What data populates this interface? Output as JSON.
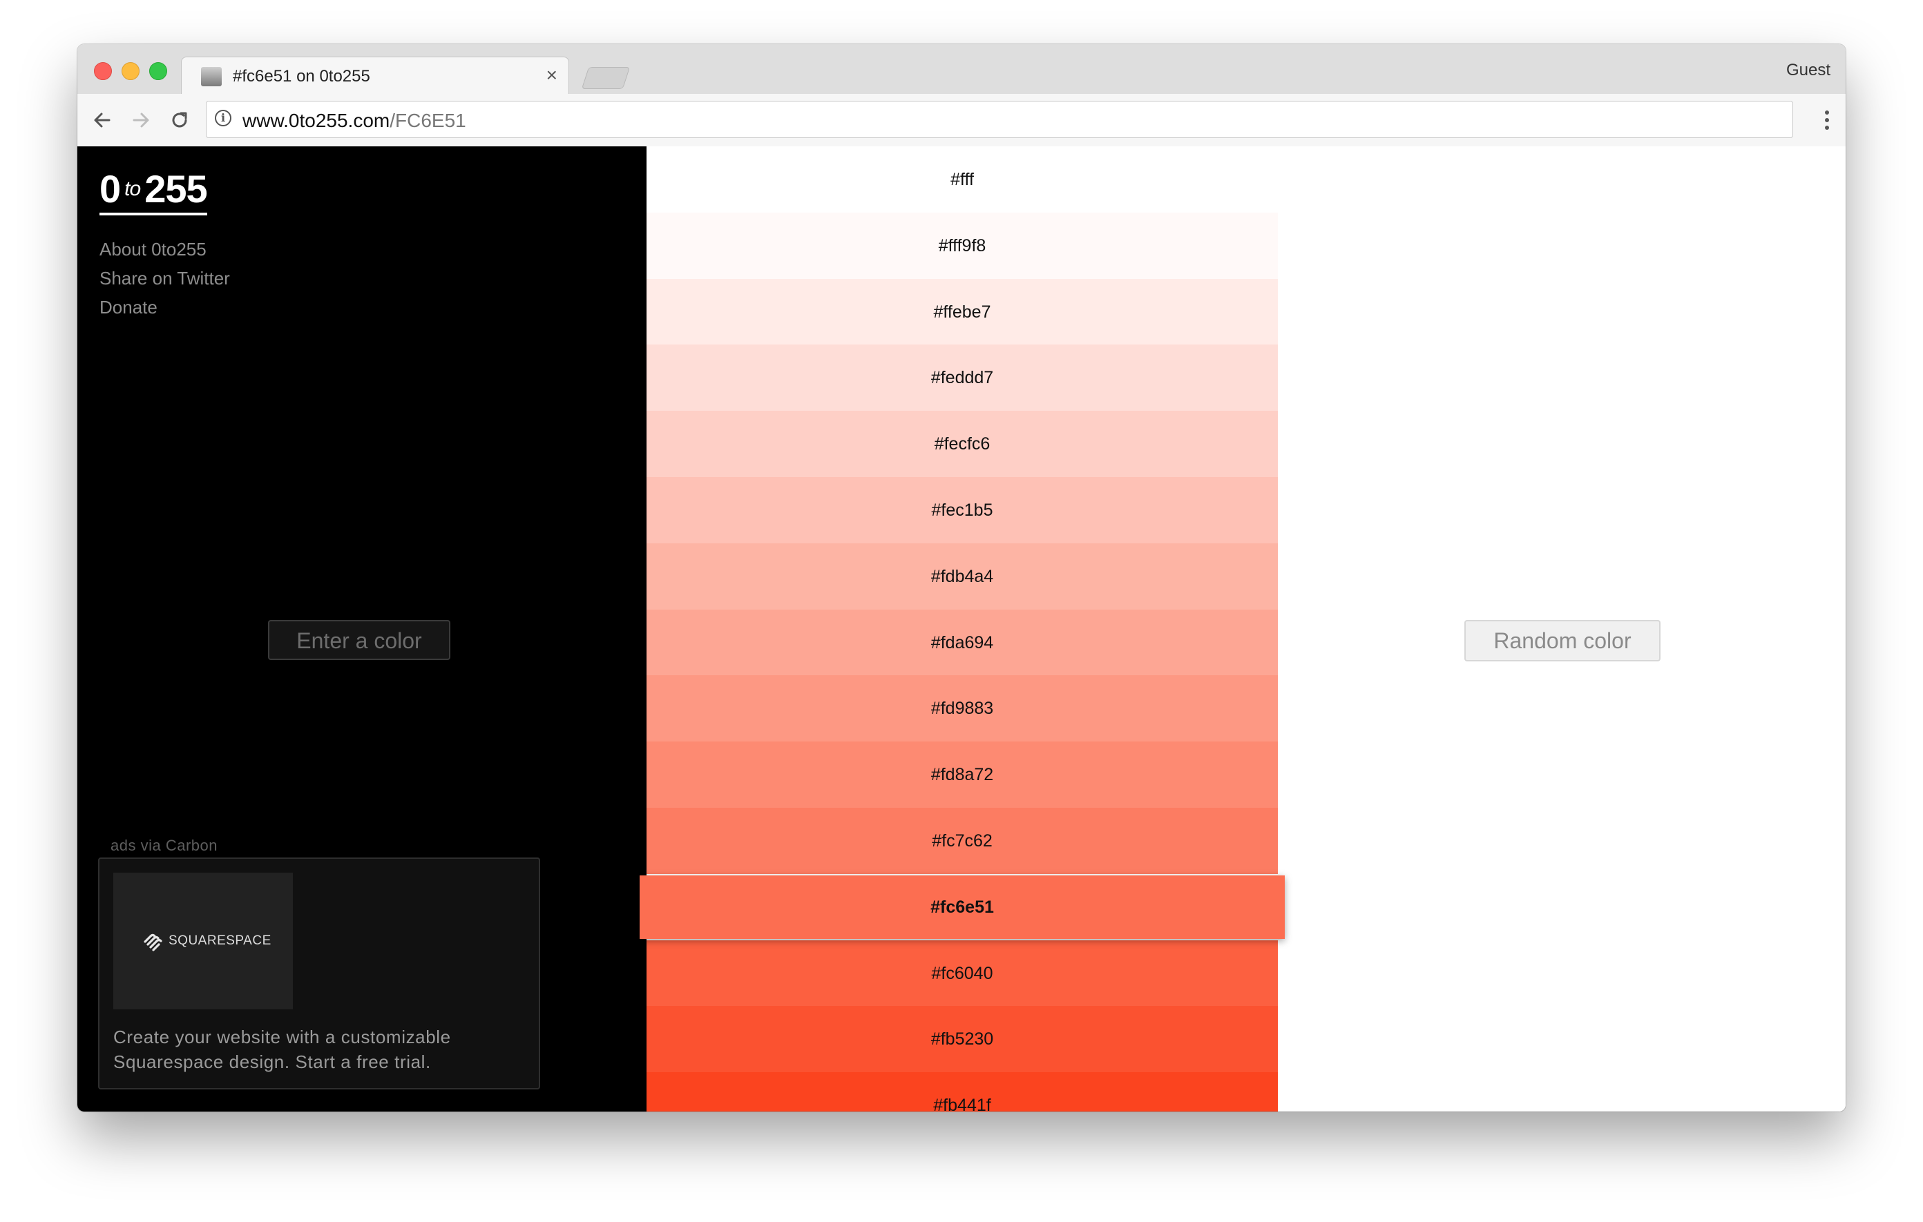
{
  "browser": {
    "tab_title": "#fc6e51 on 0to255",
    "tab_close": "×",
    "profile": "Guest",
    "url_host": "www.0to255.com",
    "url_path": "/FC6E51"
  },
  "sidebar": {
    "logo_left": "0",
    "logo_to": "to",
    "logo_right": "255",
    "links": [
      "About 0to255",
      "Share on Twitter",
      "Donate"
    ],
    "enter_color_placeholder": "Enter a color"
  },
  "ad": {
    "label": "ads via Carbon",
    "brand": "SQUARESPACE",
    "text": "Create your website with a customizable Squarespace design. Start a free trial."
  },
  "shades": [
    {
      "hex": "#fff",
      "color": "#ffffff"
    },
    {
      "hex": "#fff9f8",
      "color": "#fff9f8"
    },
    {
      "hex": "#ffebe7",
      "color": "#ffebe7"
    },
    {
      "hex": "#feddd7",
      "color": "#feddd7"
    },
    {
      "hex": "#fecfc6",
      "color": "#fecfc6"
    },
    {
      "hex": "#fec1b5",
      "color": "#fec1b5"
    },
    {
      "hex": "#fdb4a4",
      "color": "#fdb4a4"
    },
    {
      "hex": "#fda694",
      "color": "#fda694"
    },
    {
      "hex": "#fd9883",
      "color": "#fd9883"
    },
    {
      "hex": "#fd8a72",
      "color": "#fd8a72"
    },
    {
      "hex": "#fc7c62",
      "color": "#fc7c62"
    },
    {
      "hex": "#fc6e51",
      "color": "#fc6e51",
      "active": true
    },
    {
      "hex": "#fc6040",
      "color": "#fc6040"
    },
    {
      "hex": "#fb5230",
      "color": "#fb5230"
    },
    {
      "hex": "#fb441f",
      "color": "#fb441f"
    }
  ],
  "random_color_label": "Random color"
}
